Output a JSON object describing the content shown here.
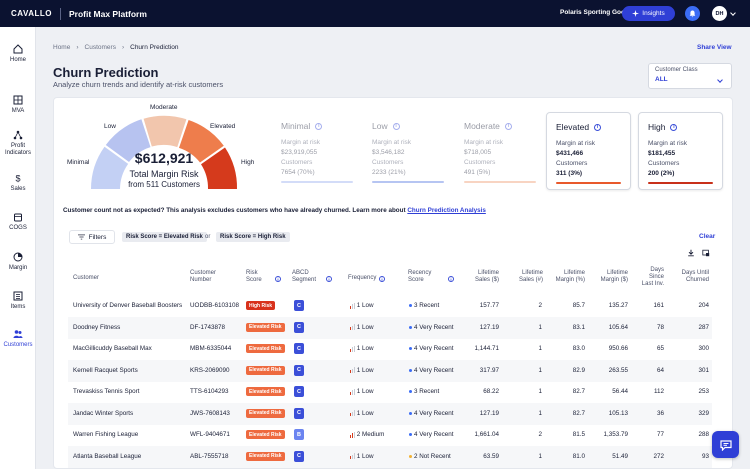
{
  "topbar": {
    "brand": "CAVALLO",
    "product": "Profit Max Platform",
    "company": "Polaris Sporting Goods",
    "insights_label": "Insights",
    "user_initials": "DH"
  },
  "sidebar": {
    "items": [
      {
        "label": "Home",
        "icon": "home-icon"
      },
      {
        "label": "MVA",
        "icon": "grid-icon"
      },
      {
        "label": "Profit Indicators",
        "icon": "network-icon"
      },
      {
        "label": "Sales",
        "icon": "dollar-icon"
      },
      {
        "label": "COGS",
        "icon": "box-icon"
      },
      {
        "label": "Margin",
        "icon": "pie-icon"
      },
      {
        "label": "Items",
        "icon": "items-icon"
      },
      {
        "label": "Customers",
        "icon": "users-icon"
      }
    ],
    "active": "Customers"
  },
  "breadcrumb": [
    "Home",
    "Customers",
    "Churn Prediction"
  ],
  "share_label": "Share View",
  "page": {
    "title": "Churn Prediction",
    "subtitle": "Analyze churn trends and identify at-risk customers"
  },
  "customer_class": {
    "label": "Customer Class",
    "value": "ALL"
  },
  "gauge": {
    "value": "$612,921",
    "title": "Total Margin Risk",
    "subtitle": "from 511 Customers",
    "labels": [
      "Minimal",
      "Low",
      "Moderate",
      "Elevated",
      "High"
    ],
    "colors": [
      "#c3d0f4",
      "#b7c3f0",
      "#f2c6ad",
      "#ee7d4c",
      "#d53a1c"
    ]
  },
  "risk_panels": [
    {
      "title": "Minimal",
      "margin_label": "Margin at risk",
      "margin": "$23,919,055",
      "cust_label": "Customers",
      "customers": "7654 (70%)",
      "color": "#c8d4f6",
      "selected": false
    },
    {
      "title": "Low",
      "margin_label": "Margin at risk",
      "margin": "$3,546,182",
      "cust_label": "Customers",
      "customers": "2233 (21%)",
      "color": "#5f7fe4",
      "selected": false
    },
    {
      "title": "Moderate",
      "margin_label": "Margin at risk",
      "margin": "$718,005",
      "cust_label": "Customers",
      "customers": "491 (5%)",
      "color": "#f1a27a",
      "selected": false
    },
    {
      "title": "Elevated",
      "margin_label": "Margin at risk",
      "margin": "$431,466",
      "cust_label": "Customers",
      "customers": "311 (3%)",
      "color": "#e8592c",
      "selected": true
    },
    {
      "title": "High",
      "margin_label": "Margin at risk",
      "margin": "$181,455",
      "cust_label": "Customers",
      "customers": "200 (2%)",
      "color": "#c8301a",
      "selected": true
    }
  ],
  "note": {
    "text": "Customer count not as expected? This analysis excludes customers who have already churned. Learn more about ",
    "link": "Churn Prediction Analysis"
  },
  "filters": {
    "button_label": "Filters",
    "chips": [
      "Risk Score = Elevated Risk",
      "Risk Score = High Risk"
    ],
    "joiner": "or",
    "clear_label": "Clear"
  },
  "table": {
    "headers": {
      "customer": "Customer",
      "number": [
        "Customer",
        "Number"
      ],
      "risk": [
        "Risk",
        "Score"
      ],
      "abcd": [
        "ABCD",
        "Segment"
      ],
      "frequency": "Frequency",
      "recency": [
        "Recency",
        "Score"
      ],
      "sales": [
        "Lifetime",
        "Sales ($)"
      ],
      "salesn": [
        "Lifetime",
        "Sales (#)"
      ],
      "margin_pct": [
        "Lifetime",
        "Margin (%)"
      ],
      "margin_d": [
        "Lifetime",
        "Margin ($)"
      ],
      "days_since": [
        "Days",
        "Since",
        "Last Inv."
      ],
      "days_until": [
        "Days Until",
        "Churned"
      ]
    },
    "rows": [
      {
        "customer": "University of Denver Baseball Boosters",
        "number": "UODBB-6103108",
        "risk": "High Risk",
        "seg": "C",
        "freq": "1 Low",
        "freq_level": 1,
        "rec": "3 Recent",
        "rec_color": "#3b6cf5",
        "sales": "157.77",
        "salesn": "2",
        "mpct": "85.7",
        "md": "135.27",
        "since": "161",
        "until": "204"
      },
      {
        "customer": "Doodney Fitness",
        "number": "DF-1743878",
        "risk": "Elevated Risk",
        "seg": "C",
        "freq": "1 Low",
        "freq_level": 1,
        "rec": "4 Very Recent",
        "rec_color": "#3b6cf5",
        "sales": "127.19",
        "salesn": "1",
        "mpct": "83.1",
        "md": "105.64",
        "since": "78",
        "until": "287"
      },
      {
        "customer": "MacGillicuddy Baseball Max",
        "number": "MBM-6335044",
        "risk": "Elevated Risk",
        "seg": "C",
        "freq": "1 Low",
        "freq_level": 1,
        "rec": "4 Very Recent",
        "rec_color": "#3b6cf5",
        "sales": "1,144.71",
        "salesn": "1",
        "mpct": "83.0",
        "md": "950.66",
        "since": "65",
        "until": "300"
      },
      {
        "customer": "Kernell Racquet Sports",
        "number": "KRS-2069090",
        "risk": "Elevated Risk",
        "seg": "C",
        "freq": "1 Low",
        "freq_level": 1,
        "rec": "4 Very Recent",
        "rec_color": "#3b6cf5",
        "sales": "317.97",
        "salesn": "1",
        "mpct": "82.9",
        "md": "263.55",
        "since": "64",
        "until": "301"
      },
      {
        "customer": "Trevaskiss Tennis Sport",
        "number": "TTS-6104293",
        "risk": "Elevated Risk",
        "seg": "C",
        "freq": "1 Low",
        "freq_level": 1,
        "rec": "3 Recent",
        "rec_color": "#3b6cf5",
        "sales": "68.22",
        "salesn": "1",
        "mpct": "82.7",
        "md": "56.44",
        "since": "112",
        "until": "253"
      },
      {
        "customer": "Jandac Winter Sports",
        "number": "JWS-7608143",
        "risk": "Elevated Risk",
        "seg": "C",
        "freq": "1 Low",
        "freq_level": 1,
        "rec": "4 Very Recent",
        "rec_color": "#3b6cf5",
        "sales": "127.19",
        "salesn": "1",
        "mpct": "82.7",
        "md": "105.13",
        "since": "36",
        "until": "329"
      },
      {
        "customer": "Warren Fishing League",
        "number": "WFL-9404671",
        "risk": "Elevated Risk",
        "seg": "B",
        "freq": "2 Medium",
        "freq_level": 2,
        "rec": "4 Very Recent",
        "rec_color": "#3b6cf5",
        "sales": "1,661.04",
        "salesn": "2",
        "mpct": "81.5",
        "md": "1,353.79",
        "since": "77",
        "until": "288"
      },
      {
        "customer": "Atlanta Baseball League",
        "number": "ABL-7555718",
        "risk": "Elevated Risk",
        "seg": "C",
        "freq": "1 Low",
        "freq_level": 1,
        "rec": "2 Not Recent",
        "rec_color": "#f2b233",
        "sales": "63.59",
        "salesn": "1",
        "mpct": "81.0",
        "md": "51.49",
        "since": "272",
        "until": "93"
      }
    ]
  },
  "colors": {
    "accent": "#2f3fd6",
    "high_risk": "#d8321c",
    "elevated_risk": "#ee6a3f",
    "seg_c": "#3b4fd8",
    "seg_b": "#6b84f0"
  }
}
